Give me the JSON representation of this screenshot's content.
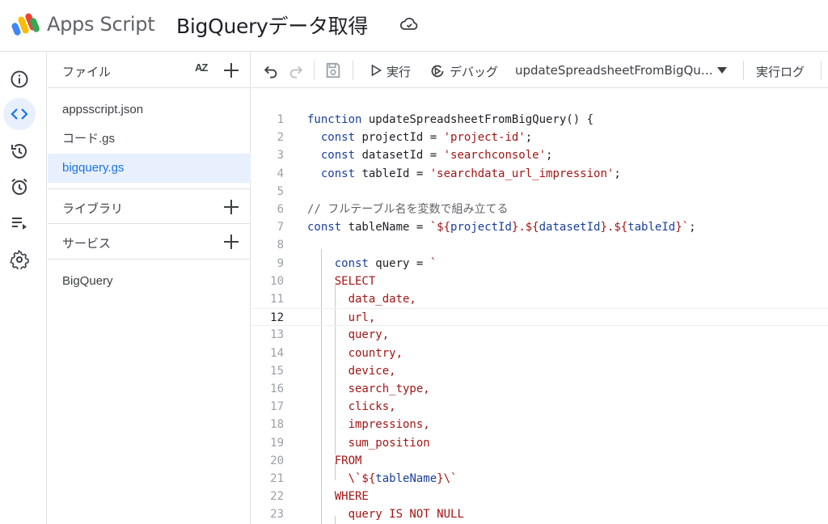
{
  "header": {
    "app_name": "Apps Script",
    "project_title": "BigQueryデータ取得"
  },
  "rail": {
    "items": [
      "overview",
      "editor",
      "triggers-history",
      "triggers",
      "executions",
      "settings"
    ],
    "active": "editor"
  },
  "files_panel": {
    "files_label": "ファイル",
    "sort_label": "AZ",
    "files": [
      {
        "name": "appsscript.json",
        "active": false
      },
      {
        "name": "コード.gs",
        "active": false
      },
      {
        "name": "bigquery.gs",
        "active": true
      }
    ],
    "libraries_label": "ライブラリ",
    "services_label": "サービス",
    "services": [
      "BigQuery"
    ]
  },
  "toolbar": {
    "run_label": "実行",
    "debug_label": "デバッグ",
    "function_select": "updateSpreadsheetFromBigQu…",
    "log_label": "実行ログ"
  },
  "editor": {
    "current_line": 12,
    "lines": [
      {
        "n": "1",
        "segments": [
          [
            "kw",
            "function "
          ],
          [
            "",
            "updateSpreadsheetFromBigQuery() {"
          ]
        ]
      },
      {
        "n": "2",
        "segments": [
          [
            "",
            "  "
          ],
          [
            "kw",
            "const "
          ],
          [
            "",
            "projectId = "
          ],
          [
            "str",
            "'project-id'"
          ],
          [
            "",
            ";"
          ]
        ]
      },
      {
        "n": "3",
        "segments": [
          [
            "",
            "  "
          ],
          [
            "kw",
            "const "
          ],
          [
            "",
            "datasetId = "
          ],
          [
            "str",
            "'searchconsole'"
          ],
          [
            "",
            ";"
          ]
        ]
      },
      {
        "n": "4",
        "segments": [
          [
            "",
            "  "
          ],
          [
            "kw",
            "const "
          ],
          [
            "",
            "tableId = "
          ],
          [
            "str",
            "'searchdata_url_impression'"
          ],
          [
            "",
            ";"
          ]
        ]
      },
      {
        "n": "5",
        "segments": []
      },
      {
        "n": "6",
        "segments": [
          [
            "cm",
            "// フルテーブル名を変数で組み立てる"
          ]
        ]
      },
      {
        "n": "7",
        "segments": [
          [
            "kw",
            "const "
          ],
          [
            "",
            "tableName = "
          ],
          [
            "str",
            "`${"
          ],
          [
            "tv",
            "projectId"
          ],
          [
            "str",
            "}.${"
          ],
          [
            "tv",
            "datasetId"
          ],
          [
            "str",
            "}.${"
          ],
          [
            "tv",
            "tableId"
          ],
          [
            "str",
            "}`"
          ],
          [
            "",
            ";"
          ]
        ]
      },
      {
        "n": "8",
        "segments": []
      },
      {
        "n": "9",
        "segments": [
          [
            "",
            "    "
          ],
          [
            "kw",
            "const "
          ],
          [
            "",
            "query = "
          ],
          [
            "str",
            "`"
          ]
        ]
      },
      {
        "n": "10",
        "segments": [
          [
            "",
            "    "
          ],
          [
            "str",
            "SELECT"
          ]
        ]
      },
      {
        "n": "11",
        "segments": [
          [
            "",
            "      "
          ],
          [
            "str",
            "data_date,"
          ]
        ]
      },
      {
        "n": "12",
        "segments": [
          [
            "",
            "      "
          ],
          [
            "str",
            "url,"
          ]
        ]
      },
      {
        "n": "13",
        "segments": [
          [
            "",
            "      "
          ],
          [
            "str",
            "query,"
          ]
        ]
      },
      {
        "n": "14",
        "segments": [
          [
            "",
            "      "
          ],
          [
            "str",
            "country,"
          ]
        ]
      },
      {
        "n": "15",
        "segments": [
          [
            "",
            "      "
          ],
          [
            "str",
            "device,"
          ]
        ]
      },
      {
        "n": "16",
        "segments": [
          [
            "",
            "      "
          ],
          [
            "str",
            "search_type,"
          ]
        ]
      },
      {
        "n": "17",
        "segments": [
          [
            "",
            "      "
          ],
          [
            "str",
            "clicks,"
          ]
        ]
      },
      {
        "n": "18",
        "segments": [
          [
            "",
            "      "
          ],
          [
            "str",
            "impressions,"
          ]
        ]
      },
      {
        "n": "19",
        "segments": [
          [
            "",
            "      "
          ],
          [
            "str",
            "sum_position"
          ]
        ]
      },
      {
        "n": "20",
        "segments": [
          [
            "",
            "    "
          ],
          [
            "str",
            "FROM"
          ]
        ]
      },
      {
        "n": "21",
        "segments": [
          [
            "",
            "      "
          ],
          [
            "str",
            "\\`${"
          ],
          [
            "tv",
            "tableName"
          ],
          [
            "str",
            "}\\`"
          ]
        ]
      },
      {
        "n": "22",
        "segments": [
          [
            "",
            "    "
          ],
          [
            "str",
            "WHERE"
          ]
        ]
      },
      {
        "n": "23",
        "segments": [
          [
            "",
            "      "
          ],
          [
            "str",
            "query IS NOT NULL"
          ]
        ]
      }
    ]
  },
  "colors": {
    "accent": "#1a73e8",
    "active_bg": "#e8f0fe",
    "keyword": "#1a3f9b",
    "string": "#a31515",
    "comment": "#5f6368"
  }
}
